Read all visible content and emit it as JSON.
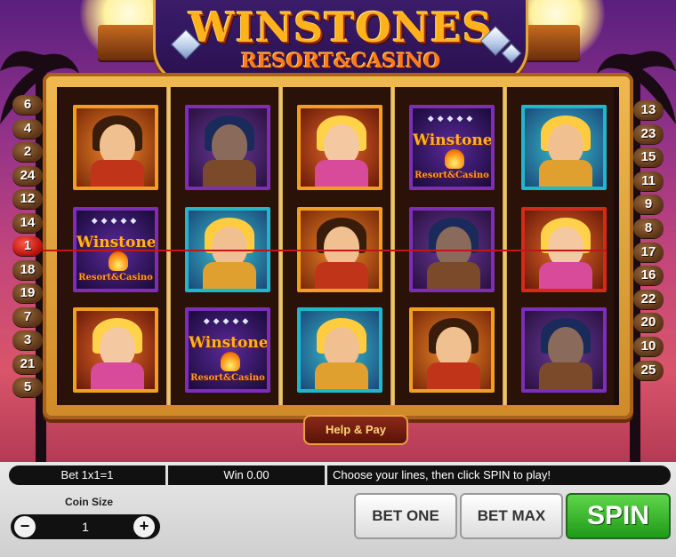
{
  "title": {
    "main": "WINSTONES",
    "sub": "RESORT&CASINO"
  },
  "colors": {
    "accent": "#ffb21c",
    "spin": "#2fae22",
    "payline": "#c0161a",
    "active_badge": "#d0201a"
  },
  "left_lines": [
    "6",
    "4",
    "2",
    "24",
    "12",
    "14",
    "1",
    "18",
    "19",
    "7",
    "3",
    "21",
    "5"
  ],
  "right_lines": [
    "13",
    "23",
    "15",
    "11",
    "9",
    "8",
    "17",
    "16",
    "22",
    "20",
    "10",
    "25"
  ],
  "active_line": "1",
  "reels": [
    [
      {
        "symbol": "winstone-man",
        "frame": "orange"
      },
      {
        "symbol": "logo",
        "frame": "purple"
      },
      {
        "symbol": "blonde-woman",
        "frame": "orange"
      }
    ],
    [
      {
        "symbol": "hippo-captain",
        "frame": "purple"
      },
      {
        "symbol": "couple",
        "frame": "teal"
      },
      {
        "symbol": "logo",
        "frame": "purple"
      }
    ],
    [
      {
        "symbol": "blonde-woman",
        "frame": "orange"
      },
      {
        "symbol": "winstone-man",
        "frame": "orange"
      },
      {
        "symbol": "couple",
        "frame": "teal"
      }
    ],
    [
      {
        "symbol": "logo",
        "frame": "purple"
      },
      {
        "symbol": "hippo-captain",
        "frame": "purple"
      },
      {
        "symbol": "winstone-man",
        "frame": "orange"
      }
    ],
    [
      {
        "symbol": "couple",
        "frame": "teal"
      },
      {
        "symbol": "blonde-woman",
        "frame": "red"
      },
      {
        "symbol": "hippo-captain",
        "frame": "purple"
      }
    ]
  ],
  "symbol_logo": {
    "main": "Winstones",
    "sub": "Resort&Casino"
  },
  "help_label": "Help & Pay",
  "status": {
    "bet": "Bet 1x1=1",
    "win": "Win 0.00",
    "message": "Choose your lines, then click SPIN to play!"
  },
  "coin": {
    "label": "Coin Size",
    "value": "1",
    "minus": "−",
    "plus": "+"
  },
  "buttons": {
    "bet_one": "BET ONE",
    "bet_max": "BET MAX",
    "spin": "SPIN"
  }
}
